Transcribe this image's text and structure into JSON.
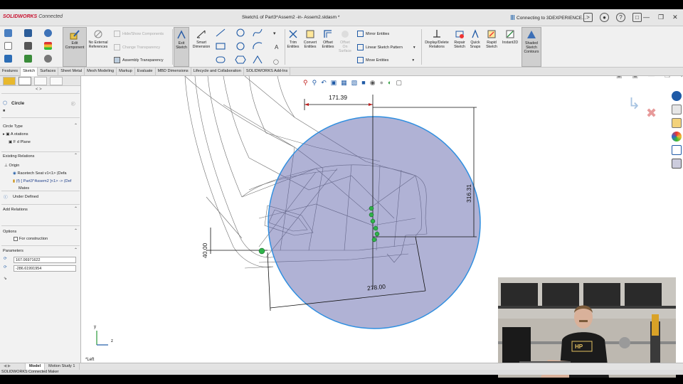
{
  "app": {
    "logo_brand": "SOLIDWORKS",
    "logo_suffix": "Connected",
    "document_title": "Sketch1 of Part3^Assem2 -in- Assem2.sldasm *",
    "connecting": "Connecting to 3DEXPERIENCE...",
    "top_icons": [
      "terminal-icon",
      "user-icon",
      "help-icon",
      "bell-icon"
    ],
    "window_controls": [
      "minimize-icon",
      "restore-icon",
      "close-icon"
    ]
  },
  "ribbon": {
    "edit_component": "Edit Component",
    "no_external_references": "No External References",
    "hide_show_components": "Hide/Show Components",
    "change_transparency": "Change Transparency",
    "assembly_transparency": "Assembly Transparency",
    "exit_sketch": "Exit Sketch",
    "smart_dimension": "Smart Dimension",
    "trim_entities": "Trim Entities",
    "convert_entities": "Convert Entities",
    "offset_entities": "Offset Entities",
    "offset_on_surface": "Offset On Surface",
    "mirror_entities": "Mirror Entities",
    "linear_sketch_pattern": "Linear Sketch Pattern",
    "move_entities": "Move Entities",
    "display_delete_relations": "Display/Delete Relations",
    "repair_sketch": "Repair Sketch",
    "quick_snaps": "Quick Snaps",
    "rapid_sketch": "Rapid Sketch",
    "instant2d": "Instant2D",
    "shaded_sketch_contours": "Shaded Sketch Contours"
  },
  "tabs": [
    "Features",
    "Sketch",
    "Surfaces",
    "Sheet Metal",
    "Mesh Modeling",
    "Markup",
    "Evaluate",
    "MBD Dimensions",
    "Lifecycle and Collaboration",
    "SOLIDWORKS Add-Ins"
  ],
  "active_tab": "Sketch",
  "property_manager": {
    "title": "Circle",
    "circle_type": "Circle Type",
    "tree_annotations": "A    otations",
    "tree_plane": "F    d Plane",
    "existing_relations": "Existing Relations",
    "relation_origin": "Origin",
    "relation_seat": "Racetech Seat v1<1> (Defa",
    "relation_part": "(f) [ Part3^Assem2 ]<1> -> (Def",
    "relation_mates": "Mates",
    "under_defined": "Under Defined",
    "add_relations": "Add Relations",
    "options": "Options",
    "for_construction": "For construction",
    "parameters": "Parameters",
    "param_x": "167.06971622",
    "param_y": "-286.61991954"
  },
  "viewport": {
    "dim_width": "171.39",
    "dim_radius": "316.31",
    "dim_height": "40.00",
    "dim_diameter": "278.00",
    "view_name": "*Left",
    "triad_x": "z",
    "triad_y": "y"
  },
  "bottom_tabs": [
    "Model",
    "Motion Study 1"
  ],
  "status_text": "SOLIDWORKS Connected Maker",
  "colors": {
    "circle_fill": "#5a5ea8",
    "circle_stroke": "#2f8fe0",
    "snap_points": "#2fb34a",
    "logo": "#c8102e"
  }
}
